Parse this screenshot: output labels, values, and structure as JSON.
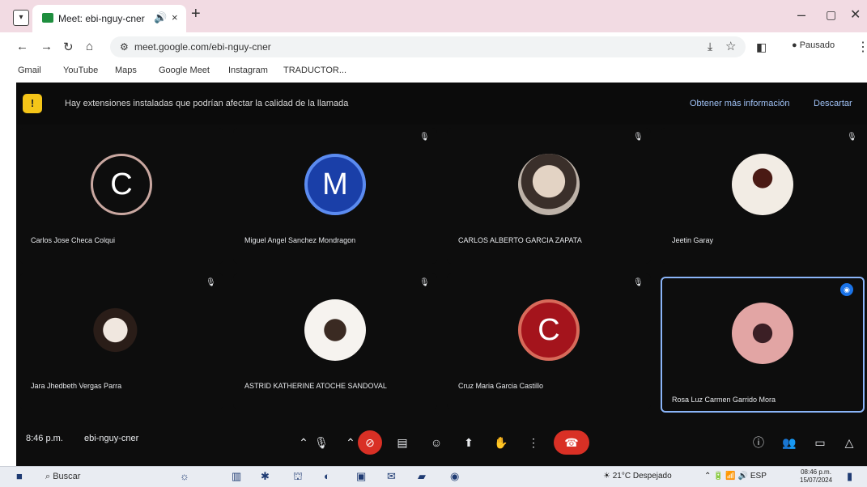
{
  "browser": {
    "tab_title": "Meet: ebi-nguy-cner",
    "url": "meet.google.com/ebi-nguy-cner",
    "profile_label": "Pausado",
    "bookmarks": [
      "Gmail",
      "YouTube",
      "Maps",
      "Google Meet",
      "Instagram",
      "TRADUCTOR..."
    ]
  },
  "banner": {
    "text": "Hay extensiones instaladas que podrían afectar la calidad de la llamada",
    "link": "Obtener más información",
    "dismiss": "Descartar"
  },
  "participants": [
    {
      "name": "Carlos Jose Checa Colqui",
      "initial": "C",
      "avatar": "ring",
      "muted": false
    },
    {
      "name": "Miguel Angel Sanchez Mondragon",
      "initial": "M",
      "avatar": "blue",
      "muted": true
    },
    {
      "name": "CARLOS ALBERTO GARCIA ZAPATA",
      "initial": "",
      "avatar": "photo1",
      "muted": true
    },
    {
      "name": "Jeetin Garay",
      "initial": "",
      "avatar": "photo2",
      "muted": true
    },
    {
      "name": "Jara Jhedbeth Vergas Parra",
      "initial": "",
      "avatar": "photo3",
      "muted": true
    },
    {
      "name": "ASTRID KATHERINE ATOCHE SANDOVAL",
      "initial": "",
      "avatar": "photo4",
      "muted": true
    },
    {
      "name": "Cruz Maria Garcia Castillo",
      "initial": "C",
      "avatar": "red",
      "muted": true
    },
    {
      "name": "Rosa Luz Carmen Garrido Mora",
      "initial": "",
      "avatar": "photo5",
      "muted": false,
      "active": true
    }
  ],
  "controls": {
    "time": "8:46 p.m.",
    "meeting_code": "ebi-nguy-cner"
  },
  "taskbar": {
    "search_label": "Buscar",
    "weather": "21°C Despejado",
    "tray_lang": "ESP",
    "clock_time": "08:46 p.m.",
    "clock_date": "15/07/2024"
  },
  "colors": {
    "meet_bg": "#0d0d0d",
    "end_call": "#d93025",
    "active_border": "#8ab4f8",
    "tab_strip": "#f2dbe3"
  }
}
